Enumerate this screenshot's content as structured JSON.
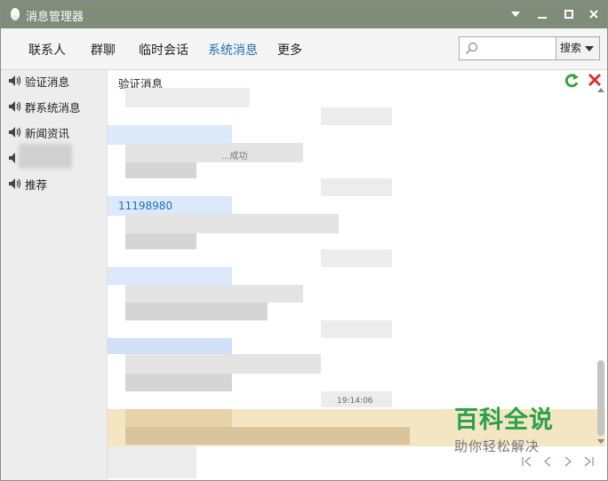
{
  "window": {
    "title": "消息管理器"
  },
  "nav": {
    "tabs": [
      {
        "label": "联系人"
      },
      {
        "label": "群聊"
      },
      {
        "label": "临时会话"
      },
      {
        "label": "系统消息"
      },
      {
        "label": "更多"
      }
    ],
    "active_tab": "系统消息",
    "search": {
      "placeholder": "",
      "button_label": "搜索"
    }
  },
  "sidebar": {
    "items": [
      {
        "label": "验证消息"
      },
      {
        "label": "群系统消息"
      },
      {
        "label": "新闻资讯"
      },
      {
        "label": ""
      },
      {
        "label": "推荐"
      }
    ]
  },
  "content": {
    "title": "验证消息",
    "visible_id": "11198980",
    "fragment_1": "...成功",
    "fragment_2": "19:14:06"
  },
  "watermark": {
    "main": "百科全说",
    "sub": "助你轻松解决"
  },
  "colors": {
    "titlebar": "#7f8c7a",
    "accent": "#1f6fb2",
    "watermark": "#2aa24a"
  }
}
